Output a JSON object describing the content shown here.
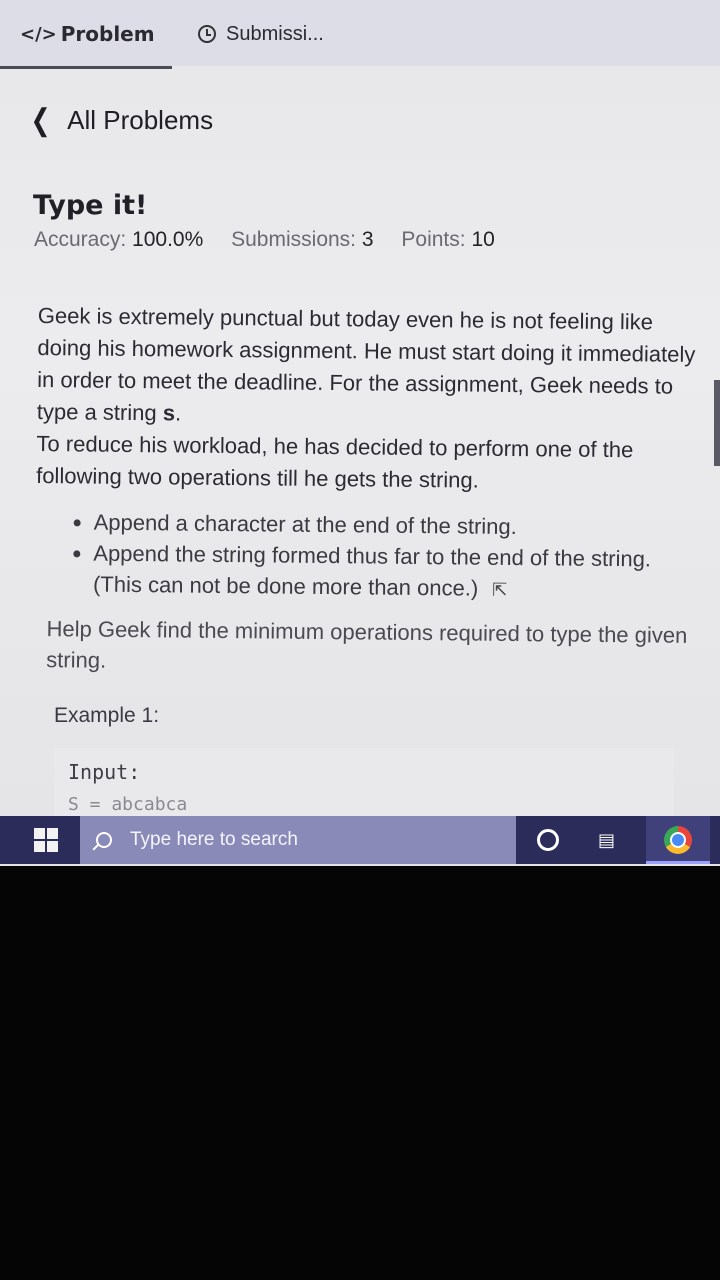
{
  "tabs": {
    "problem_icon": "</>",
    "problem_label": "Problem",
    "submissions_label": "Submissi..."
  },
  "nav": {
    "back_label": "All Problems"
  },
  "problem": {
    "title": "Type it!",
    "accuracy_label": "Accuracy:",
    "accuracy_value": "100.0%",
    "submissions_label": "Submissions:",
    "submissions_value": "3",
    "points_label": "Points:",
    "points_value": "10",
    "desc_para1_a": "Geek is extremely punctual but today even he is not feeling like doing his homework assignment. He must start doing it immediately in order to meet the deadline. For the assignment, Geek needs to type a string ",
    "desc_para1_var": "s",
    "desc_para1_b": ".",
    "desc_para2": "To reduce his workload, he has decided to perform one of the following two operations till he gets the string.",
    "bullets": [
      "Append a character at the end of the string.",
      "Append the string formed thus far to the end of the string. (This can not be done more than once.)"
    ],
    "help_text": "Help Geek find the minimum operations required to type the given string.",
    "example_title": "Example 1:",
    "example_input_label": "Input:",
    "example_input_value": "S = abcabca"
  },
  "taskbar": {
    "search_placeholder": "Type here to search",
    "icons": [
      "windows-start-icon",
      "search-icon",
      "cortana-icon",
      "task-view-icon",
      "chrome-icon"
    ]
  }
}
